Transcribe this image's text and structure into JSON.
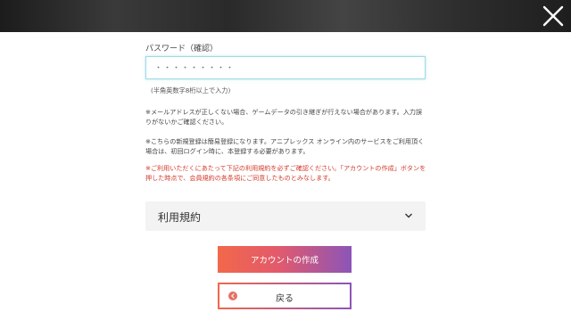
{
  "header": {
    "close_icon": "close-icon"
  },
  "form": {
    "confirm_password_label": "パスワード（確認）",
    "confirm_password_value": "・・・・・・・・・",
    "password_hint": "(半角英数字8桁以上で入力)"
  },
  "notes": {
    "email_note": "※メールアドレスが正しくない場合、ゲームデータの引き継ぎが行えない場合があります。入力誤りがないかご確認ください。",
    "simple_registration_note": "※こちらの新規登録は簡易登録になります。アニプレックス オンライン内のサービスをご利用頂く場合は、初回ログイン時に、本登録する必要があります。",
    "terms_agreement_note": "※ご利用いただくにあたって下記の利用規約を必ずご確認ください。「アカウントの作成」ボタンを押した時点で、会員規約の各条項にご同意したものとみなします。"
  },
  "terms": {
    "label": "利用規約",
    "expand_icon": "chevron-down-icon"
  },
  "buttons": {
    "create_account_label": "アカウントの作成",
    "back_label": "戻る",
    "back_icon": "chevron-left-circle-icon"
  },
  "colors": {
    "accent_orange": "#f2684a",
    "accent_purple": "#8c55b8",
    "warning_red": "#d23a2a",
    "input_focus": "#9edbe6"
  }
}
